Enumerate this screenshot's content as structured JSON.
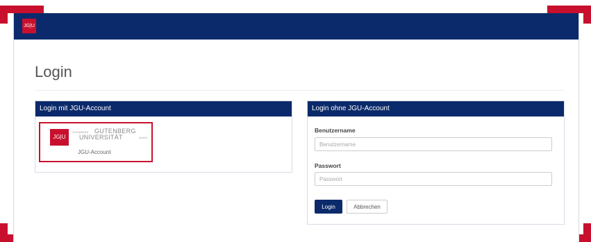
{
  "navbar": {
    "brand": "JG|U"
  },
  "page": {
    "title": "Login"
  },
  "panel_jgu": {
    "heading": "Login mit JGU-Account",
    "logo_mark": "JG|U",
    "logo_small": "JOHANNES",
    "logo_line1": "GUTENBERG",
    "logo_line2": "UNIVERSITÄT",
    "logo_city": "MAINZ",
    "caption": "JGU-Account"
  },
  "panel_local": {
    "heading": "Login ohne JGU-Account",
    "username_label": "Benutzername",
    "username_placeholder": "Benutzername",
    "username_value": "",
    "password_label": "Passwort",
    "password_placeholder": "Passwort",
    "password_value": "",
    "login_label": "Login",
    "cancel_label": "Abbrechen"
  },
  "colors": {
    "brand_blue": "#0b2a6b",
    "brand_red": "#c8102e"
  }
}
